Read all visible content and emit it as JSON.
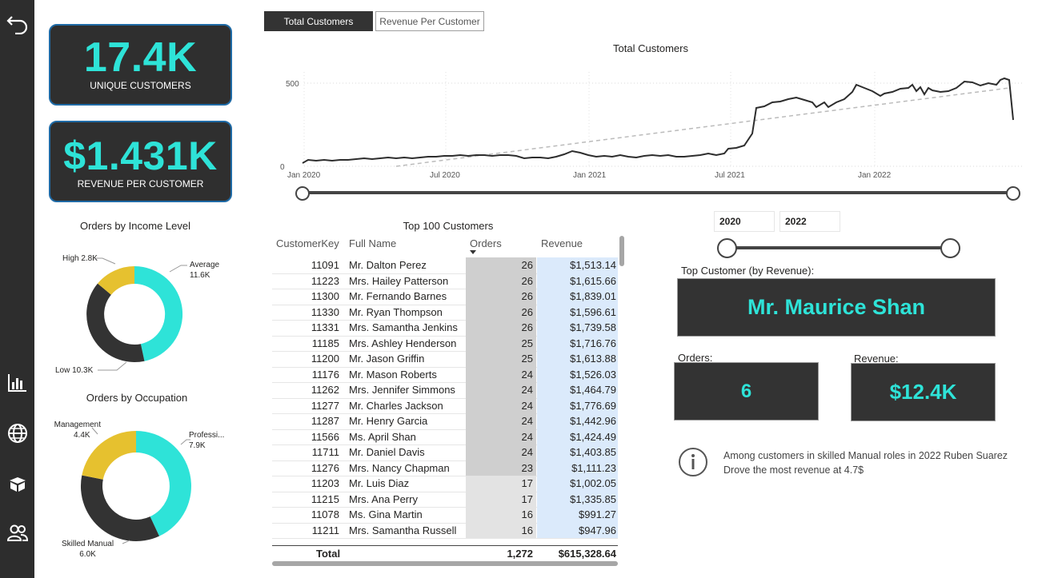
{
  "nav": {
    "icons": [
      "back-arrow-icon",
      "bar-chart-icon",
      "globe-icon",
      "box-icon",
      "people-icon"
    ]
  },
  "kpis": {
    "unique_customers": {
      "value": "17.4K",
      "label": "UNIQUE CUSTOMERS"
    },
    "revenue_per_customer": {
      "value": "$1.431K",
      "label": "REVENUE PER CUSTOMER"
    }
  },
  "tabs": [
    {
      "label": "Total Customers",
      "active": true
    },
    {
      "label": "Revenue Per Customer",
      "active": false
    }
  ],
  "line_chart": {
    "title": "Total Customers",
    "y_ticks": [
      "500",
      "0"
    ],
    "x_ticks": [
      "Jan 2020",
      "Jul 2020",
      "Jan 2021",
      "Jul 2021",
      "Jan 2022"
    ]
  },
  "income_donut": {
    "title": "Orders by Income Level",
    "labels": [
      {
        "name": "Average",
        "value": "11.6K"
      },
      {
        "name": "Low",
        "value": "10.3K",
        "text": "Low 10.3K"
      },
      {
        "name": "High",
        "value": "2.8K",
        "text": "High 2.8K"
      }
    ]
  },
  "occupation_donut": {
    "title": "Orders by Occupation",
    "labels": [
      {
        "name": "Professi...",
        "value": "7.9K"
      },
      {
        "name": "Skilled Manual",
        "value": "6.0K"
      },
      {
        "name": "Management",
        "value": "4.4K"
      }
    ]
  },
  "table": {
    "title": "Top 100 Customers",
    "headers": [
      "CustomerKey",
      "Full Name",
      "Orders",
      "Revenue"
    ],
    "rows": [
      [
        "11091",
        "Mr. Dalton Perez",
        "26",
        "$1,513.14"
      ],
      [
        "11223",
        "Mrs. Hailey Patterson",
        "26",
        "$1,615.66"
      ],
      [
        "11300",
        "Mr. Fernando Barnes",
        "26",
        "$1,839.01"
      ],
      [
        "11330",
        "Mr. Ryan Thompson",
        "26",
        "$1,596.61"
      ],
      [
        "11331",
        "Mrs. Samantha Jenkins",
        "26",
        "$1,739.58"
      ],
      [
        "11185",
        "Mrs. Ashley Henderson",
        "25",
        "$1,716.76"
      ],
      [
        "11200",
        "Mr. Jason Griffin",
        "25",
        "$1,613.88"
      ],
      [
        "11176",
        "Mr. Mason Roberts",
        "24",
        "$1,526.03"
      ],
      [
        "11262",
        "Mrs. Jennifer Simmons",
        "24",
        "$1,464.79"
      ],
      [
        "11277",
        "Mr. Charles Jackson",
        "24",
        "$1,776.69"
      ],
      [
        "11287",
        "Mr. Henry Garcia",
        "24",
        "$1,442.96"
      ],
      [
        "11566",
        "Ms. April Shan",
        "24",
        "$1,424.49"
      ],
      [
        "11711",
        "Mr. Daniel Davis",
        "24",
        "$1,403.85"
      ],
      [
        "11276",
        "Mrs. Nancy Chapman",
        "23",
        "$1,111.23"
      ],
      [
        "11203",
        "Mr. Luis Diaz",
        "17",
        "$1,002.05"
      ],
      [
        "11215",
        "Mrs. Ana Perry",
        "17",
        "$1,335.85"
      ],
      [
        "11078",
        "Ms. Gina Martin",
        "16",
        "$991.27"
      ],
      [
        "11211",
        "Mrs. Samantha Russell",
        "16",
        "$947.96"
      ]
    ],
    "total": {
      "label": "Total",
      "orders": "1,272",
      "revenue": "$615,328.64"
    }
  },
  "year_filter": {
    "start": "2020",
    "end": "2022"
  },
  "top_customer": {
    "label": "Top Customer (by Revenue):",
    "name": "Mr. Maurice Shan",
    "orders_label": "Orders:",
    "orders_value": "6",
    "revenue_label": "Revenue:",
    "revenue_value": "$12.4K"
  },
  "insight": {
    "icon": "info-icon",
    "line1": "Among customers in skilled Manual roles in 2022 Ruben Suarez",
    "line2": "Drove the most revenue at 4.7$"
  },
  "colors": {
    "accent": "#2ee3d8",
    "dark": "#333333",
    "yellow": "#e6c12f",
    "card_border": "#1f6aa5"
  }
}
